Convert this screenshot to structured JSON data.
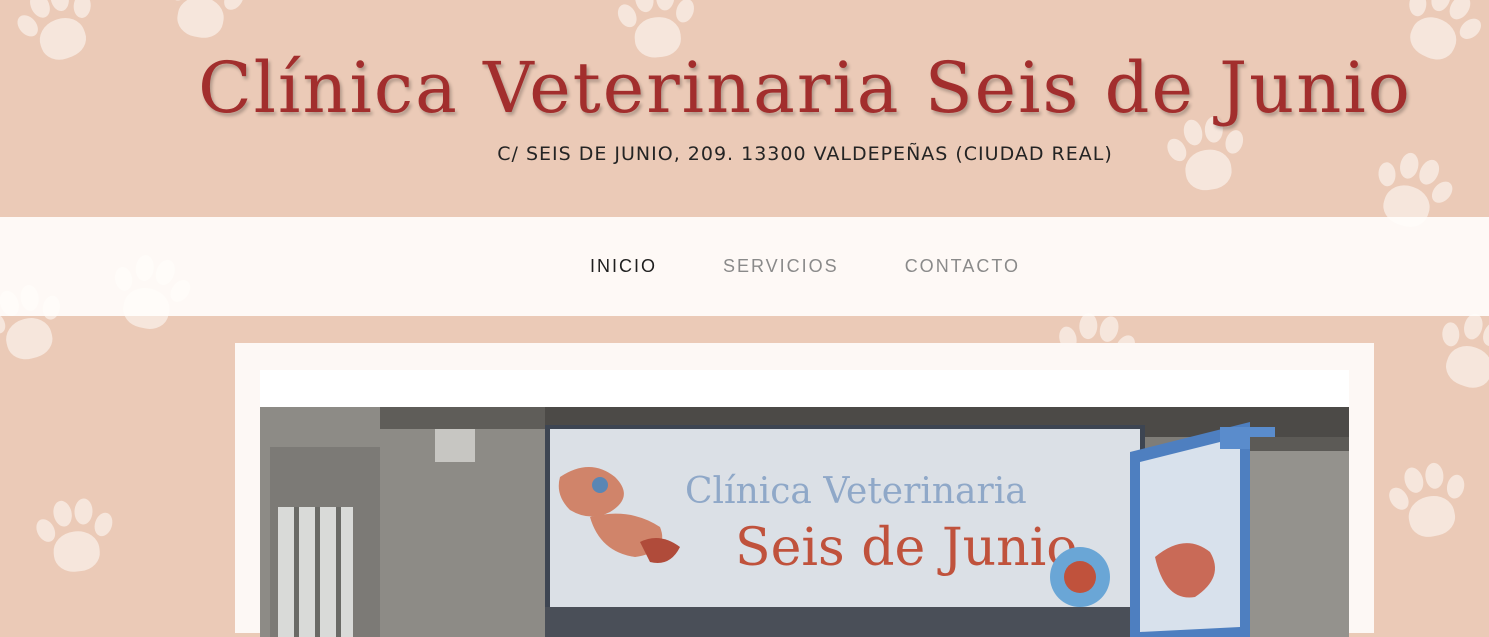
{
  "header": {
    "title": "Clínica Veterinaria Seis de Junio",
    "address": "C/ SEIS DE JUNIO, 209. 13300 VALDEPEÑAS (CIUDAD REAL)"
  },
  "nav": {
    "items": [
      {
        "label": "INICIO",
        "active": true
      },
      {
        "label": "SERVICIOS",
        "active": false
      },
      {
        "label": "CONTACTO",
        "active": false
      }
    ]
  },
  "photo": {
    "sign_line1": "Clínica Veterinaria",
    "sign_line2": "Seis de Junio"
  },
  "colors": {
    "background": "#ebcab7",
    "paw": "#f6e6dc",
    "title": "#a22e2d",
    "nav_background": "#fffdfb",
    "nav_active": "#1e1e1e",
    "nav_inactive": "#8a8a8a"
  }
}
